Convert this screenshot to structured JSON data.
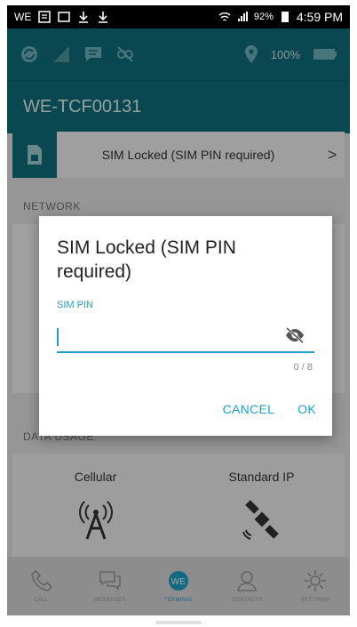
{
  "status_bar": {
    "battery": "92%",
    "time": "4:59 PM"
  },
  "toolbar": {
    "battery_level": "100%"
  },
  "app": {
    "device_id": "WE-TCF00131"
  },
  "sim_row": {
    "label": "SIM Locked (SIM PIN required)",
    "chevron": ">"
  },
  "sections": {
    "network": "NETWORK",
    "data_usage": "DATA USAGE"
  },
  "data_usage": {
    "cellular": "Cellular",
    "standard_ip": "Standard IP"
  },
  "bottom_nav": {
    "items": [
      {
        "label": "CALL"
      },
      {
        "label": "MESSAGES"
      },
      {
        "label": "TERMINAL"
      },
      {
        "label": "CONTACTS"
      },
      {
        "label": "SETTINGS"
      }
    ]
  },
  "dialog": {
    "title": "SIM Locked (SIM PIN required)",
    "field_label": "SIM PIN",
    "pin_value": "",
    "counter": "0 / 8",
    "cancel": "CANCEL",
    "ok": "OK"
  },
  "colors": {
    "primary": "#0f6f7c",
    "accent": "#1da1c6"
  }
}
